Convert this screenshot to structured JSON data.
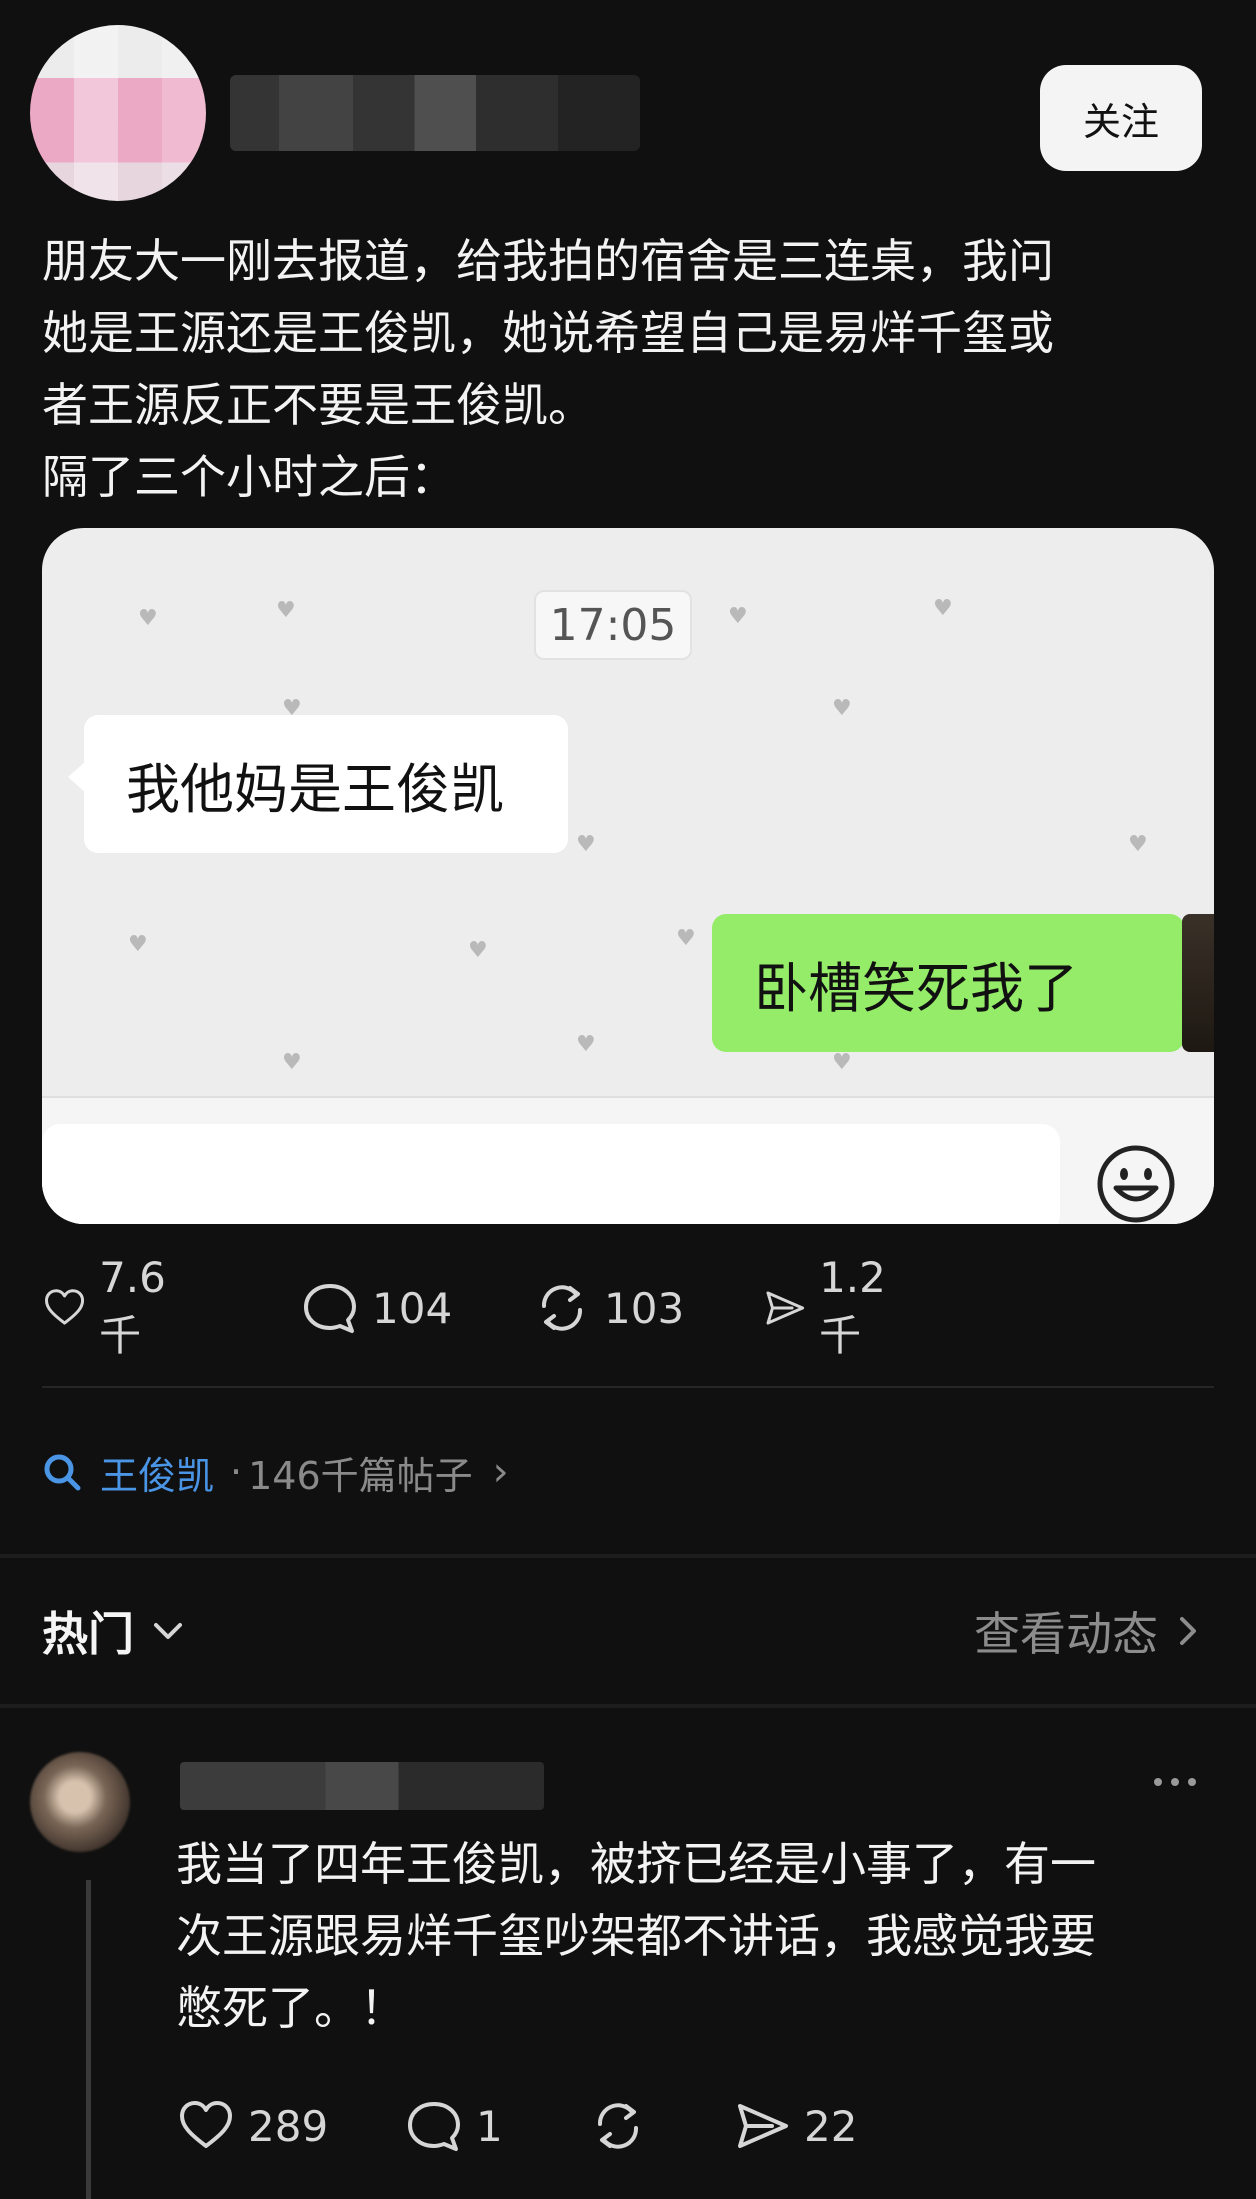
{
  "post": {
    "follow_label": "关注",
    "text": "朋友大一刚去报道，给我拍的宿舍是三连桌，我问\n她是王源还是王俊凯，她说希望自己是易烊千玺或\n者王源反正不要是王俊凯。\n隔了三个小时之后：",
    "image": {
      "time": "17:05",
      "left_message": "我他妈是王俊凯",
      "right_message": "卧槽笑死我了",
      "chat_bg_color": "#ededed",
      "sent_bubble_color": "#95ec69"
    },
    "stats": {
      "likes": "7.6千",
      "comments": "104",
      "reposts": "103",
      "shares": "1.2千"
    }
  },
  "topic": {
    "name": "王俊凯",
    "separator": "·",
    "count": "146千篇帖子"
  },
  "sort": {
    "label": "热门",
    "activity_link": "查看动态"
  },
  "comment": {
    "text": "我当了四年王俊凯，被挤已经是小事了，有一\n次王源跟易烊千玺吵架都不讲话，我感觉我要\n憋死了。！",
    "stats": {
      "likes": "289",
      "comments": "1",
      "shares": "22"
    }
  },
  "colors": {
    "background": "#101010",
    "link_blue": "#4a95e6",
    "muted_text": "#8a8a8a"
  }
}
